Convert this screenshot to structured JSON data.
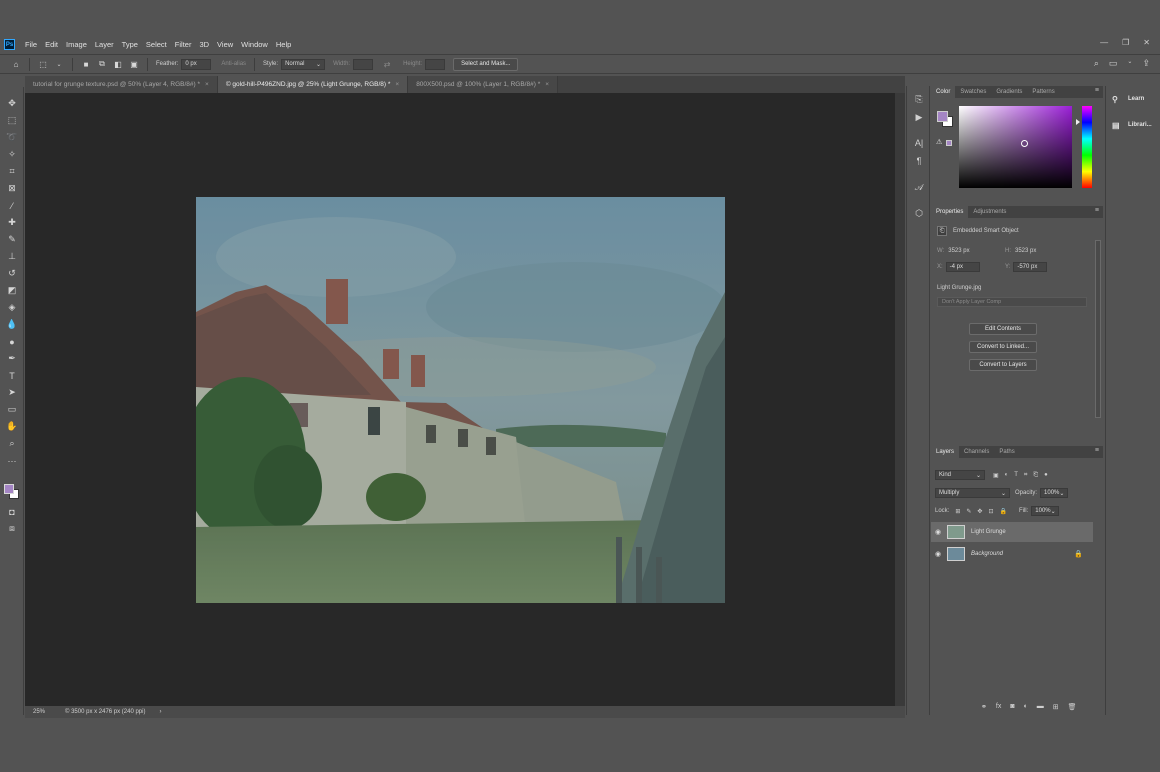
{
  "app": {
    "logo": "Ps"
  },
  "menubar": {
    "items": [
      "File",
      "Edit",
      "Image",
      "Layer",
      "Type",
      "Select",
      "Filter",
      "3D",
      "View",
      "Window",
      "Help"
    ]
  },
  "optionsbar": {
    "feather_label": "Feather:",
    "feather_value": "0 px",
    "antialias_label": "Anti-alias",
    "style_label": "Style:",
    "style_value": "Normal",
    "width_label": "Width:",
    "height_label": "Height:",
    "select_mask_label": "Select and Mask..."
  },
  "tabs": [
    {
      "label": "tutorial for grunge texture.psd @ 50% (Layer 4, RGB/8#) *",
      "active": false
    },
    {
      "label": "© gold-hill-P496ZND.jpg @ 25% (Light Grunge, RGB/8) *",
      "active": true
    },
    {
      "label": "800X500.psd @ 100% (Layer 1, RGB/8#) *",
      "active": false
    }
  ],
  "status": {
    "zoom": "25%",
    "doc_info": "© 3500 px x 2476 px (240 ppi)"
  },
  "color_panel": {
    "tabs": [
      "Color",
      "Swatches",
      "Gradients",
      "Patterns"
    ],
    "foreground": "#a485c4",
    "background": "#ffffff"
  },
  "properties_panel": {
    "tabs": [
      "Properties",
      "Adjustments"
    ],
    "type_label": "Embedded Smart Object",
    "w_label": "W:",
    "w_value": "3523 px",
    "h_label": "H:",
    "h_value": "3523 px",
    "x_label": "X:",
    "x_value": "-4 px",
    "y_label": "Y:",
    "y_value": "-570 px",
    "file_name": "Light Grunge.jpg",
    "layer_comp": "Don't Apply Layer Comp",
    "edit_contents": "Edit Contents",
    "convert_linked": "Convert to Linked...",
    "convert_layers": "Convert to Layers"
  },
  "layers_panel": {
    "tabs": [
      "Layers",
      "Channels",
      "Paths"
    ],
    "filter_kind": "Kind",
    "blend_mode": "Multiply",
    "opacity_label": "Opacity:",
    "opacity_value": "100%",
    "lock_label": "Lock:",
    "fill_label": "Fill:",
    "fill_value": "100%",
    "layers": [
      {
        "name": "Light Grunge",
        "active": true
      },
      {
        "name": "Background",
        "active": false
      }
    ]
  },
  "learn_panel": {
    "items": [
      "Learn",
      "Librari..."
    ]
  }
}
